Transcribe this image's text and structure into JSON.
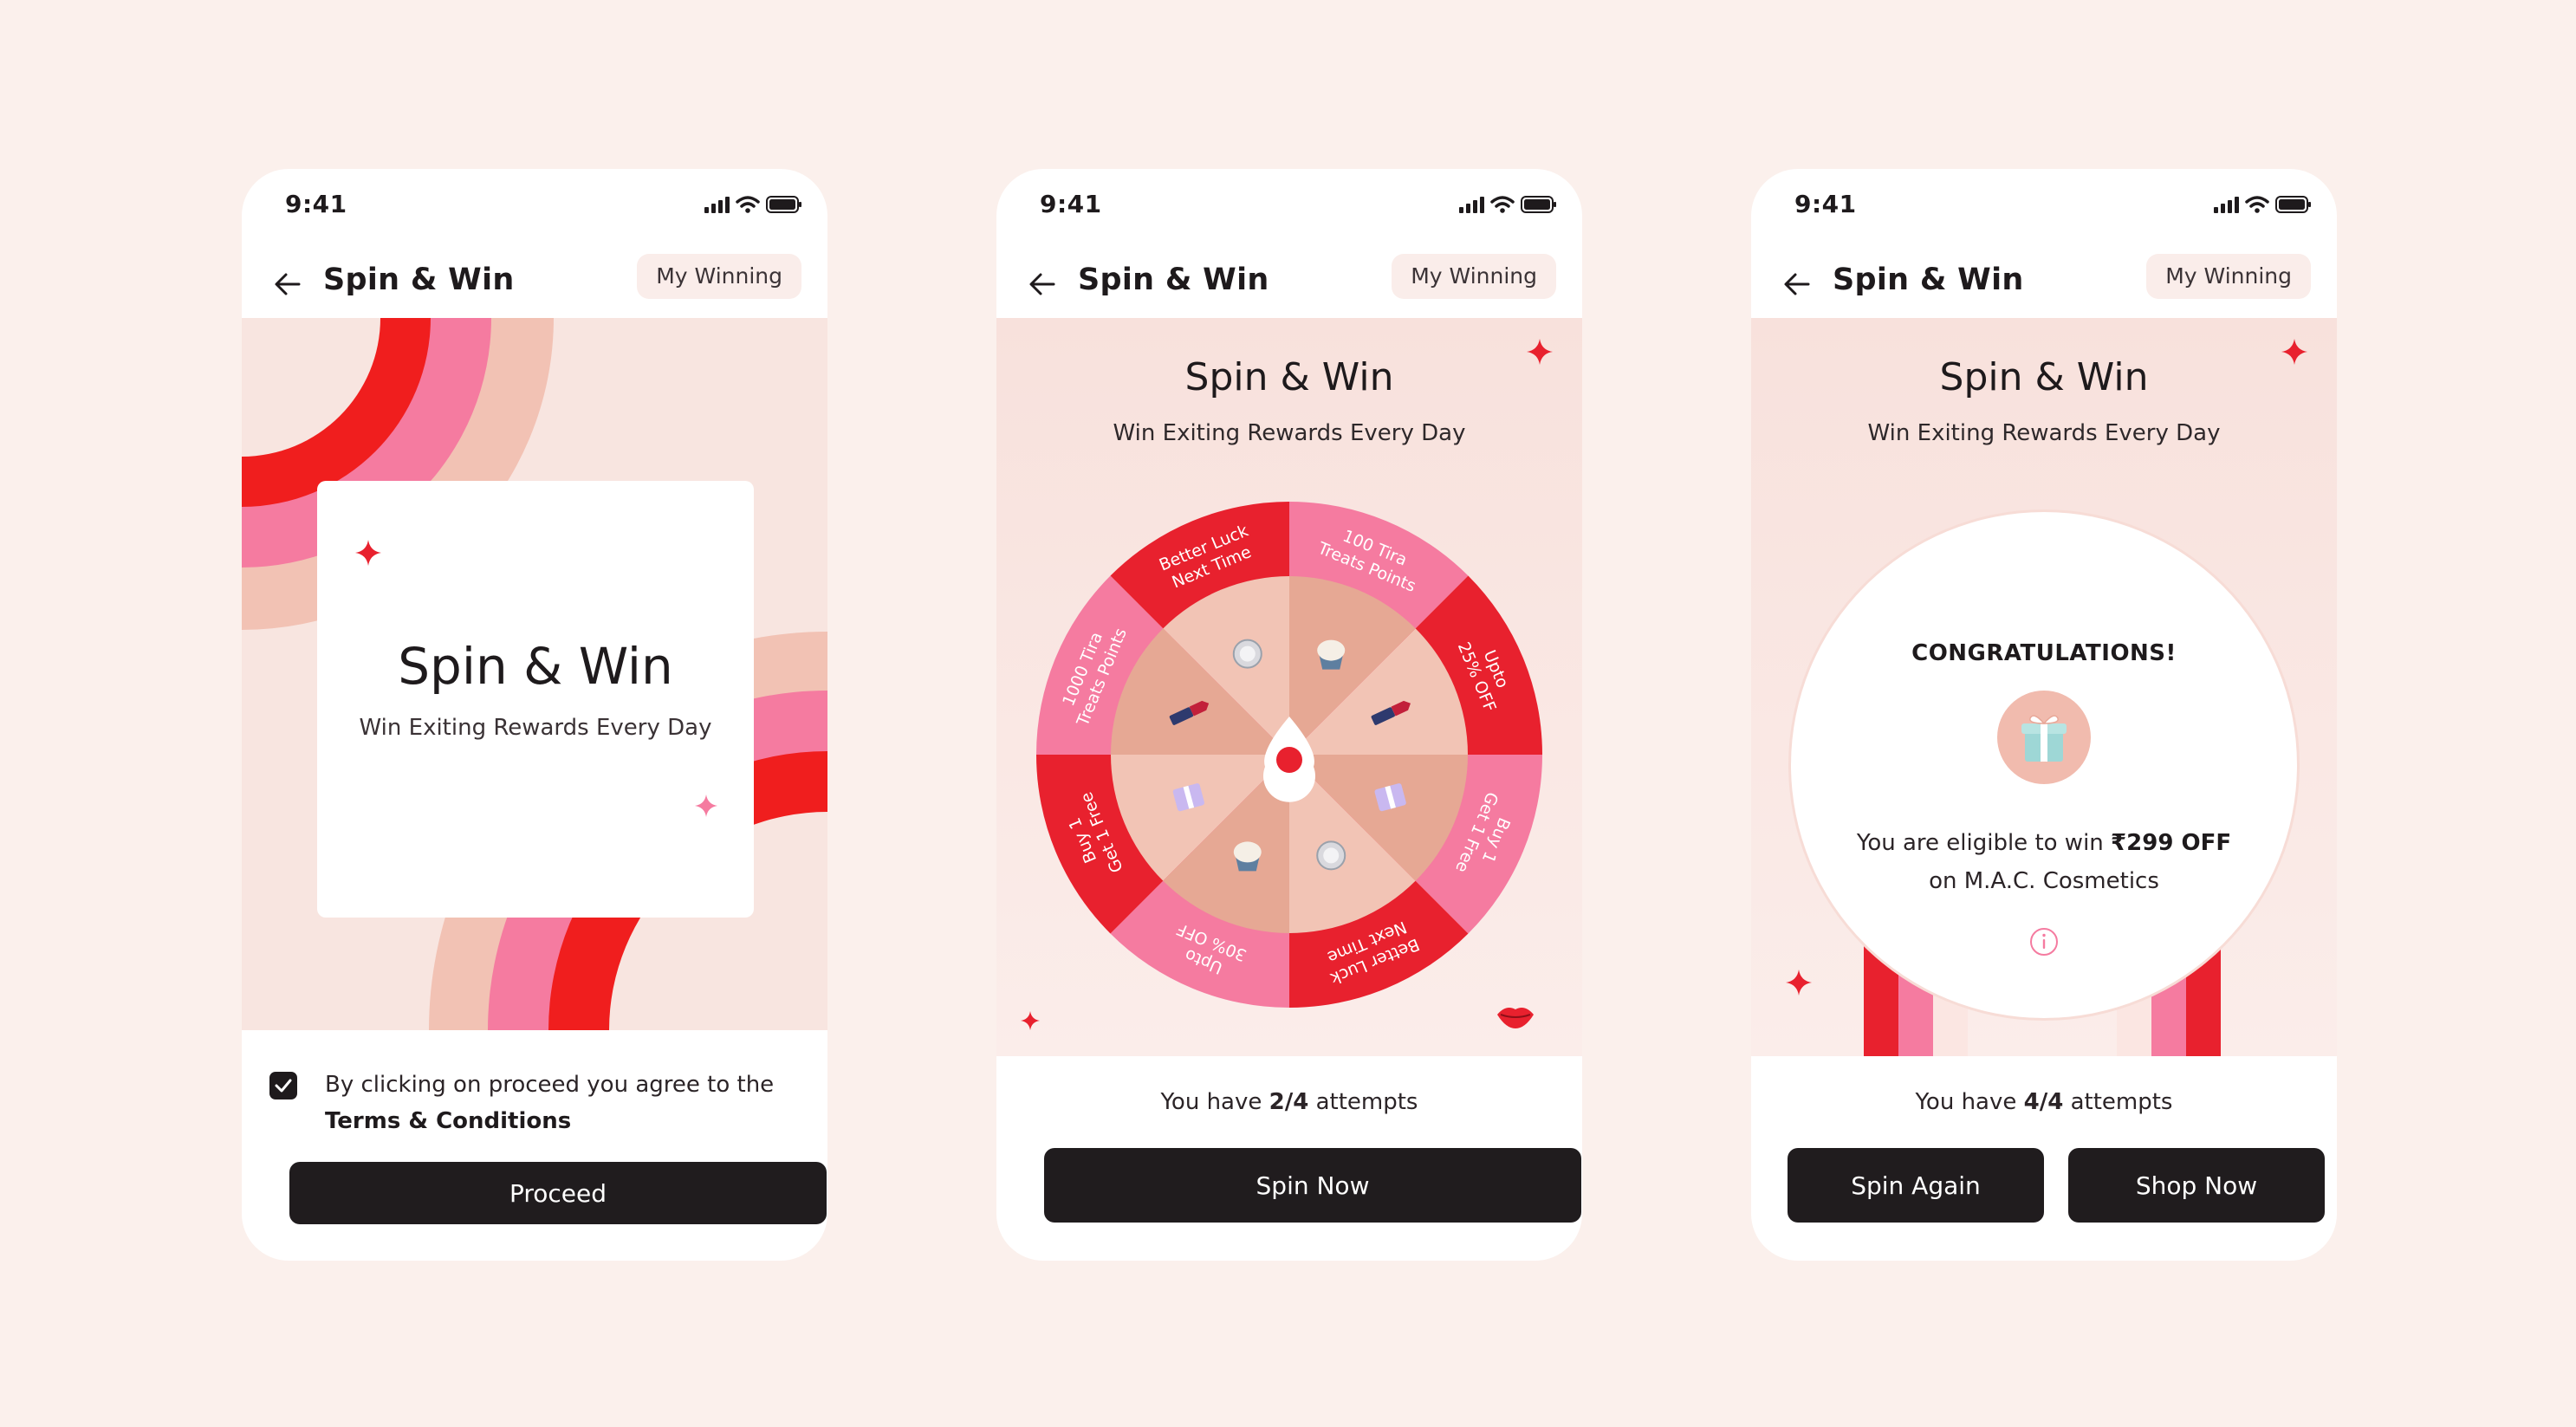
{
  "common": {
    "time": "9:41",
    "app_title": "Spin & Win",
    "my_winning_label": "My Winning"
  },
  "screen1": {
    "card_title": "Spin & Win",
    "card_subtitle": "Win Exiting Rewards Every Day",
    "terms_text": "By clicking on proceed you agree to the",
    "terms_link": "Terms & Conditions",
    "terms_checked": true,
    "proceed_label": "Proceed"
  },
  "screen2": {
    "title": "Spin & Win",
    "subtitle": "Win Exiting Rewards Every Day",
    "attempts_prefix": "You have ",
    "attempts_value": "2/4",
    "attempts_suffix": " attempts",
    "spin_label": "Spin Now",
    "wheel_segments": [
      {
        "line1": "100 Tira",
        "line2": "Treats Points",
        "color": "#F57BA0",
        "icon": "cupcake-icon"
      },
      {
        "line1": "Upto",
        "line2": "25% OFF",
        "color": "#E8212E",
        "icon": "lipstick-icon"
      },
      {
        "line1": "Buy 1",
        "line2": "Get 1 Free",
        "color": "#F57BA0",
        "icon": "gift-box-icon"
      },
      {
        "line1": "Better Luck",
        "line2": "Next Time",
        "color": "#E8212E",
        "icon": "compact-icon"
      },
      {
        "line1": "Upto",
        "line2": "30% OFF",
        "color": "#F57BA0",
        "icon": "cupcake-icon"
      },
      {
        "line1": "Buy 1",
        "line2": "Get 1 Free",
        "color": "#E8212E",
        "icon": "gift-box-icon"
      },
      {
        "line1": "1000 Tira",
        "line2": "Treats Points",
        "color": "#F57BA0",
        "icon": "lipstick-icon"
      },
      {
        "line1": "Better Luck",
        "line2": "Next Time",
        "color": "#E8212E",
        "icon": "compact-icon"
      }
    ]
  },
  "screen3": {
    "title": "Spin & Win",
    "subtitle": "Win Exiting Rewards Every Day",
    "congrats_title": "CONGRATULATIONS!",
    "eligible_text": "You are eligible to win ",
    "prize": "₹299 OFF",
    "brand_text": "on M.A.C. Cosmetics",
    "attempts_prefix": "You have ",
    "attempts_value": "4/4",
    "attempts_suffix": " attempts",
    "spin_again_label": "Spin Again",
    "shop_now_label": "Shop Now"
  },
  "colors": {
    "background": "#FBF0EC",
    "red": "#E8212E",
    "pink": "#F57BA0",
    "peach": "#F2C2B4",
    "dark": "#201C1E"
  }
}
